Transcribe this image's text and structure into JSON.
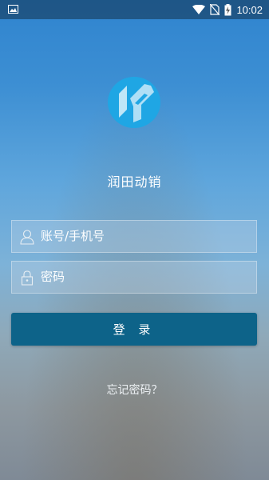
{
  "status_bar": {
    "time": "10:02",
    "icons": [
      "image-notification-icon",
      "wifi-icon",
      "no-sim-icon",
      "battery-charging-icon"
    ]
  },
  "app": {
    "logo": "app-logo",
    "name": "润田动销"
  },
  "form": {
    "account_placeholder": "账号/手机号",
    "password_placeholder": "密码",
    "login_label": "登 录",
    "forgot_label": "忘记密码？"
  },
  "colors": {
    "login_button": "#0d6389",
    "logo": "#1fa6e4"
  }
}
